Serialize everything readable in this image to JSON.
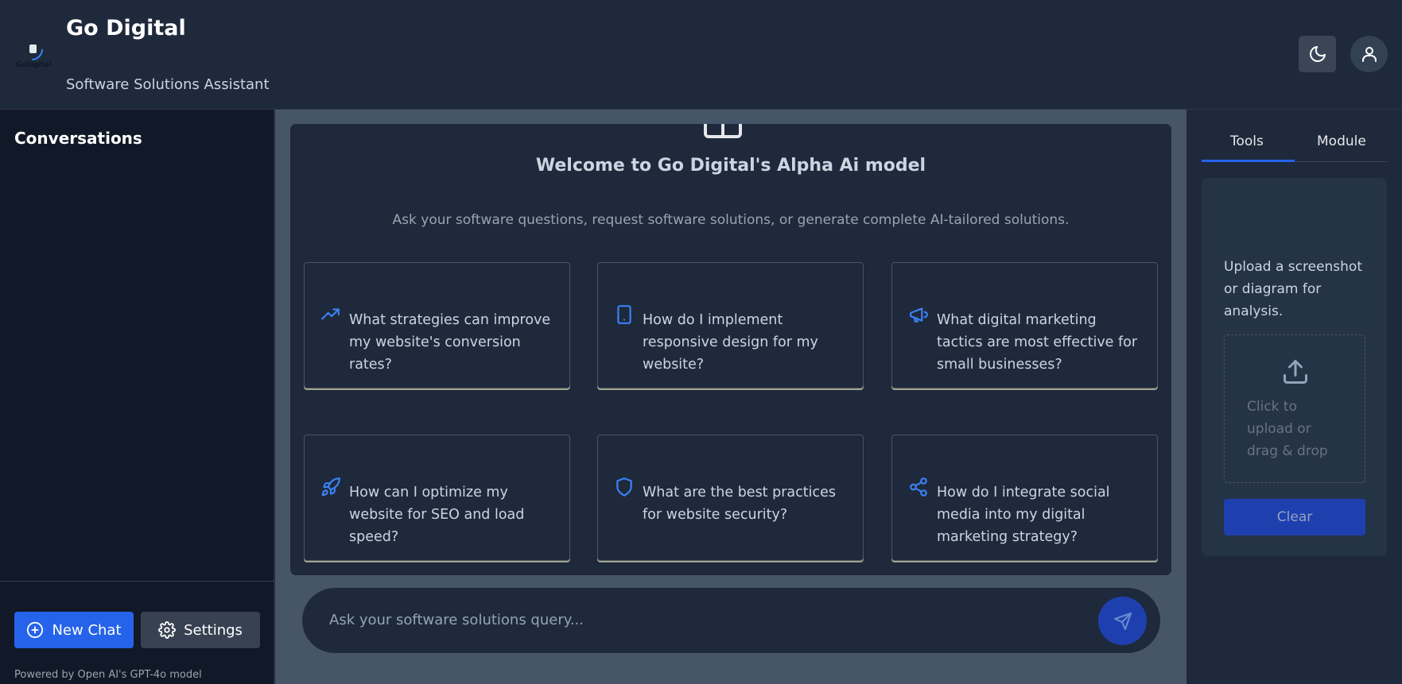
{
  "header": {
    "title": "Go Digital",
    "subtitle": "Software Solutions Assistant",
    "logo_text": "GoDigital",
    "theme_icon": "moon-icon",
    "user_icon": "user-icon"
  },
  "sidebar": {
    "title": "Conversations",
    "new_chat_label": "New Chat",
    "settings_label": "Settings",
    "powered_by": "Powered by Open AI's GPT-4o model"
  },
  "main": {
    "welcome_title": "Welcome to Go Digital's Alpha Ai model",
    "welcome_subtitle": "Ask your software questions, request software solutions, or generate complete AI-tailored solutions.",
    "prompts": [
      {
        "icon": "trending-up-icon",
        "text": "What strategies can improve my website's conversion rates?"
      },
      {
        "icon": "tablet-icon",
        "text": "How do I implement responsive design for my website?"
      },
      {
        "icon": "megaphone-icon",
        "text": "What digital marketing tactics are most effective for small businesses?"
      },
      {
        "icon": "rocket-icon",
        "text": "How can I optimize my website for SEO and load speed?"
      },
      {
        "icon": "shield-icon",
        "text": "What are the best practices for website security?"
      },
      {
        "icon": "share-icon",
        "text": "How do I integrate social media into my digital marketing strategy?"
      }
    ],
    "input_placeholder": "Ask your software solutions query..."
  },
  "right_panel": {
    "tabs": [
      {
        "label": "Tools",
        "active": true
      },
      {
        "label": "Module",
        "active": false
      }
    ],
    "upload_description": "Upload a screenshot or diagram for analysis.",
    "dropzone_text": "Click to upload or drag & drop",
    "clear_label": "Clear"
  },
  "colors": {
    "accent": "#2563eb",
    "header_bg": "#1e293b",
    "sidebar_bg": "#111827",
    "main_bg": "#475569"
  }
}
